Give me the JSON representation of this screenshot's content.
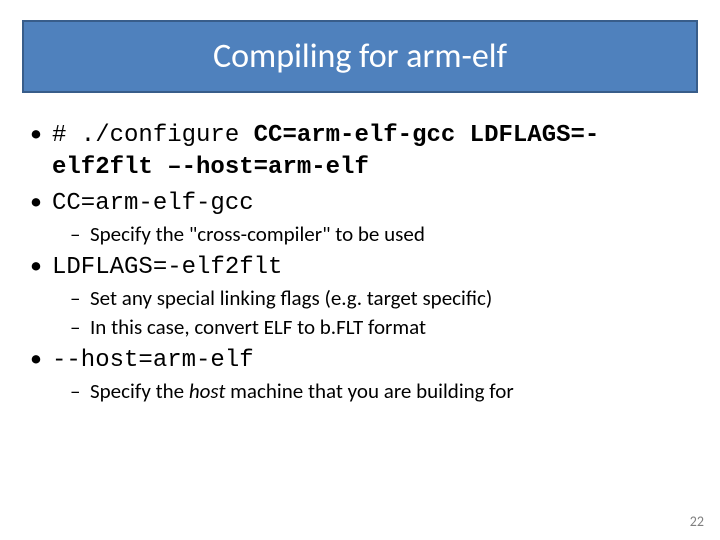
{
  "title": "Compiling for arm-elf",
  "bullets": {
    "b1_prefix": "# ./configure ",
    "b1_bold": "CC=arm-elf-gcc LDFLAGS=-elf2flt –-host=arm-elf",
    "b2": "CC=arm-elf-gcc",
    "b2_sub1_a": "Specify the ",
    "b2_sub1_q": "\"cross-compiler\"",
    "b2_sub1_b": " to be used",
    "b3": "LDFLAGS=-elf2flt",
    "b3_sub1": "Set any special linking flags (e.g. target specific)",
    "b3_sub2": "In this case, convert ELF to b.FLT format",
    "b4": "--host=arm-elf",
    "b4_sub1_a": "Specify the ",
    "b4_sub1_host": "host",
    "b4_sub1_b": " machine that you are building for"
  },
  "page_number": "22"
}
